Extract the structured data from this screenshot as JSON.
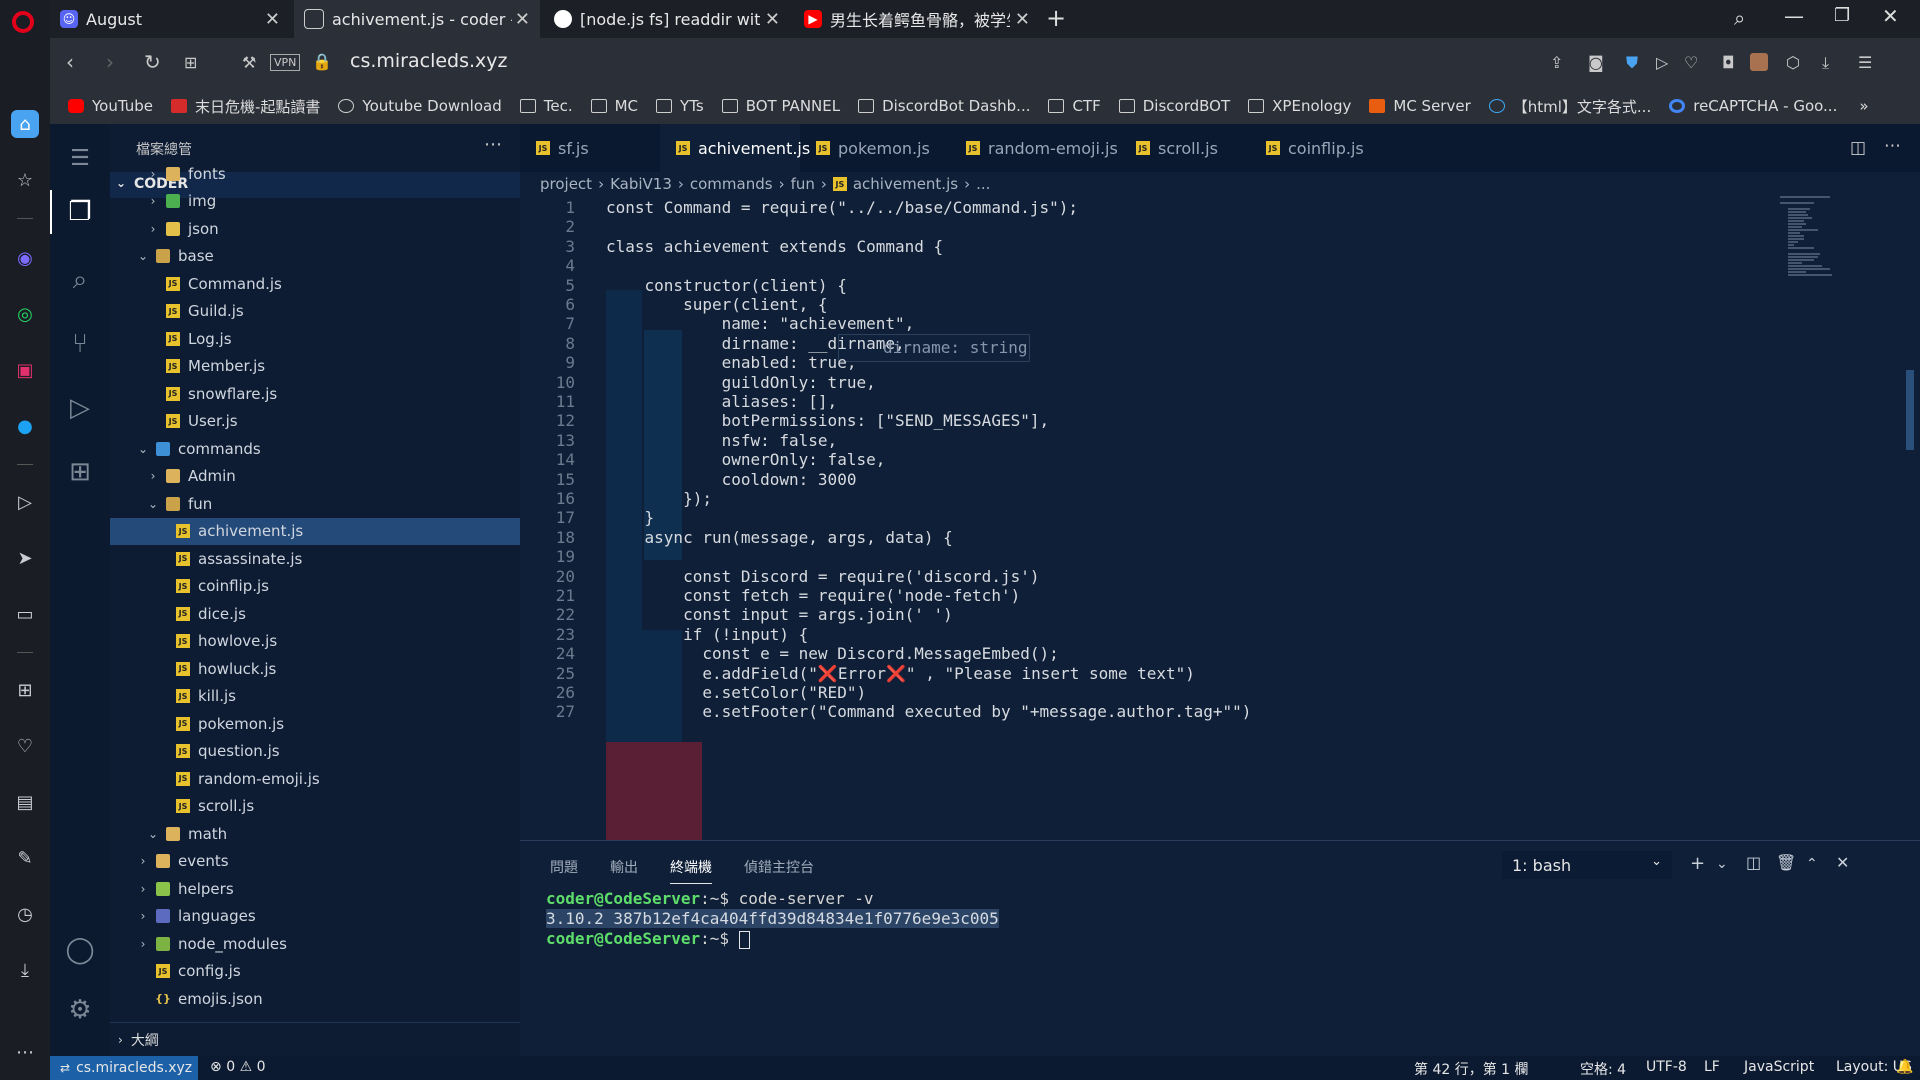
{
  "browser": {
    "tabs": [
      {
        "title": "August",
        "favicon": "discord-icon",
        "color": "#5865f2"
      },
      {
        "title": "achivement.js - coder - co",
        "favicon": "code-server-icon",
        "color": "#ffffff"
      },
      {
        "title": "[node.js fs] readdir with fi",
        "favicon": "github-icon",
        "color": "#ffffff"
      },
      {
        "title": "男生长着鳄鱼骨骼，被学生",
        "favicon": "youtube-icon",
        "color": "#ff0000"
      }
    ],
    "url": "cs.miracleds.xyz",
    "vpn_label": "VPN",
    "bookmarks": [
      {
        "label": "YouTube",
        "icon": "youtube-icon"
      },
      {
        "label": "末日危機-起點讀書",
        "icon": "qidian-icon"
      },
      {
        "label": "Youtube Download",
        "icon": "download-site-icon"
      },
      {
        "label": "Tec.",
        "icon": "folder-icon"
      },
      {
        "label": "MC",
        "icon": "folder-icon"
      },
      {
        "label": "YTs",
        "icon": "folder-icon"
      },
      {
        "label": "BOT PANNEL",
        "icon": "folder-icon"
      },
      {
        "label": "DiscordBot Dashb...",
        "icon": "folder-icon"
      },
      {
        "label": "CTF",
        "icon": "folder-icon"
      },
      {
        "label": "DiscordBOT",
        "icon": "folder-icon"
      },
      {
        "label": "XPEnology",
        "icon": "folder-icon"
      },
      {
        "label": "MC Server",
        "icon": "mc-server-icon"
      },
      {
        "label": "【html】文字各式...",
        "icon": "site-icon"
      },
      {
        "label": "reCAPTCHA - Goo...",
        "icon": "google-icon"
      }
    ]
  },
  "explorer": {
    "title": "檔案總管",
    "section": "CODER",
    "outline": "大綱",
    "items": [
      {
        "label": "fonts",
        "kind": "folder",
        "depth": 1,
        "chev": "›"
      },
      {
        "label": "img",
        "kind": "folder-img",
        "depth": 1,
        "chev": "›"
      },
      {
        "label": "json",
        "kind": "folder-json",
        "depth": 1,
        "chev": "›"
      },
      {
        "label": "base",
        "kind": "folder-open",
        "depth": 0,
        "chev": "⌄"
      },
      {
        "label": "Command.js",
        "kind": "js",
        "depth": 1,
        "chev": ""
      },
      {
        "label": "Guild.js",
        "kind": "js",
        "depth": 1,
        "chev": ""
      },
      {
        "label": "Log.js",
        "kind": "js",
        "depth": 1,
        "chev": ""
      },
      {
        "label": "Member.js",
        "kind": "js",
        "depth": 1,
        "chev": ""
      },
      {
        "label": "snowflare.js",
        "kind": "js",
        "depth": 1,
        "chev": ""
      },
      {
        "label": "User.js",
        "kind": "js",
        "depth": 1,
        "chev": ""
      },
      {
        "label": "commands",
        "kind": "folder-cmd",
        "depth": 0,
        "chev": "⌄"
      },
      {
        "label": "Admin",
        "kind": "folder",
        "depth": 1,
        "chev": "›"
      },
      {
        "label": "fun",
        "kind": "folder-open",
        "depth": 1,
        "chev": "⌄"
      },
      {
        "label": "achivement.js",
        "kind": "js",
        "depth": 2,
        "chev": "",
        "selected": true
      },
      {
        "label": "assassinate.js",
        "kind": "js",
        "depth": 2,
        "chev": ""
      },
      {
        "label": "coinflip.js",
        "kind": "js",
        "depth": 2,
        "chev": ""
      },
      {
        "label": "dice.js",
        "kind": "js",
        "depth": 2,
        "chev": ""
      },
      {
        "label": "howlove.js",
        "kind": "js",
        "depth": 2,
        "chev": ""
      },
      {
        "label": "howluck.js",
        "kind": "js",
        "depth": 2,
        "chev": ""
      },
      {
        "label": "kill.js",
        "kind": "js",
        "depth": 2,
        "chev": ""
      },
      {
        "label": "pokemon.js",
        "kind": "js",
        "depth": 2,
        "chev": ""
      },
      {
        "label": "question.js",
        "kind": "js",
        "depth": 2,
        "chev": ""
      },
      {
        "label": "random-emoji.js",
        "kind": "js",
        "depth": 2,
        "chev": ""
      },
      {
        "label": "scroll.js",
        "kind": "js",
        "depth": 2,
        "chev": ""
      },
      {
        "label": "math",
        "kind": "folder",
        "depth": 1,
        "chev": "⌄"
      },
      {
        "label": "events",
        "kind": "folder",
        "depth": 0,
        "chev": "›"
      },
      {
        "label": "helpers",
        "kind": "folder-help",
        "depth": 0,
        "chev": "›"
      },
      {
        "label": "languages",
        "kind": "folder-lang",
        "depth": 0,
        "chev": "›"
      },
      {
        "label": "node_modules",
        "kind": "folder-node",
        "depth": 0,
        "chev": "›"
      },
      {
        "label": "config.js",
        "kind": "js",
        "depth": 0,
        "chev": ""
      },
      {
        "label": "emojis.json",
        "kind": "json",
        "depth": 0,
        "chev": ""
      }
    ]
  },
  "editor": {
    "tabs": [
      {
        "label": "sf.js",
        "active": false
      },
      {
        "label": "achivement.js",
        "active": true
      },
      {
        "label": "pokemon.js",
        "active": false
      },
      {
        "label": "random-emoji.js",
        "active": false
      },
      {
        "label": "scroll.js",
        "active": false
      },
      {
        "label": "coinflip.js",
        "active": false
      }
    ],
    "breadcrumb": [
      "project",
      "KabiV13",
      "commands",
      "fun",
      "achivement.js",
      "..."
    ],
    "hint": "dirname: string",
    "lines": [
      "const Command = require(\"../../base/Command.js\");",
      "",
      "class achievement extends Command {",
      "",
      "    constructor(client) {",
      "        super(client, {",
      "            name: \"achievement\",",
      "            dirname: __dirname,",
      "            enabled: true,",
      "            guildOnly: true,",
      "            aliases: [],",
      "            botPermissions: [\"SEND_MESSAGES\"],",
      "            nsfw: false,",
      "            ownerOnly: false,",
      "            cooldown: 3000",
      "        });",
      "    }",
      "    async run(message, args, data) {",
      "",
      "        const Discord = require('discord.js')",
      "        const fetch = require('node-fetch')",
      "        const input = args.join(' ')",
      "        if (!input) {",
      "          const e = new Discord.MessageEmbed();",
      "          e.addField(\"❌Error❌\" , \"Please insert some text\")",
      "          e.setColor(\"RED\")",
      "          e.setFooter(\"Command executed by \"+message.author.tag+\"\")"
    ]
  },
  "panel": {
    "tabs": [
      "問題",
      "輸出",
      "終端機",
      "偵錯主控台"
    ],
    "active_tab": "終端機",
    "terminal_select": "1: bash",
    "terminal": [
      {
        "prompt": "coder@CodeServer",
        "suffix": ":~$ ",
        "cmd": "code-server -v"
      },
      {
        "output": "3.10.2 387b12ef4ca404ffd39d84834e1f0776e9e3c005"
      },
      {
        "prompt": "coder@CodeServer",
        "suffix": ":~$ ",
        "cmd": ""
      }
    ]
  },
  "status": {
    "remote": "cs.miracleds.xyz",
    "errors": "0",
    "warnings": "0",
    "position": "第 42 行，第 1 欄",
    "spaces": "空格: 4",
    "encoding": "UTF-8",
    "eol": "LF",
    "language": "JavaScript",
    "layout": "Layout: US"
  }
}
